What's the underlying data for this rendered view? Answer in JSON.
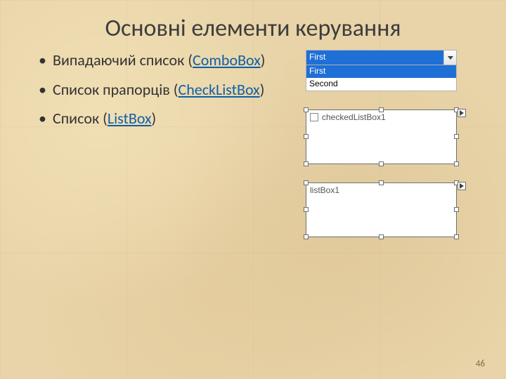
{
  "title": "Основні елементи керування",
  "bullets": [
    {
      "text": "Випадаючий список  ",
      "link": "ComboBox"
    },
    {
      "text": "Список прапорців ",
      "link": "CheckListBox"
    },
    {
      "text": "Список ",
      "link": "ListBox"
    }
  ],
  "combo": {
    "selected": "First",
    "options": [
      "First",
      "Second"
    ]
  },
  "checkedListBox": {
    "label": "checkedListBox1"
  },
  "listBox": {
    "label": "listBox1"
  },
  "pageNumber": "46"
}
